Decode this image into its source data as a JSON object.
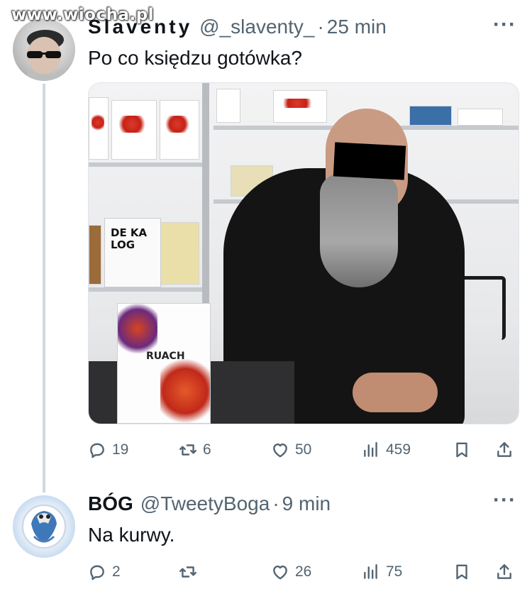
{
  "watermark": "www.wiocha.pl",
  "tweets": [
    {
      "display_name": "Slaventy",
      "handle": "@_slaventy_",
      "separator": "·",
      "time": "25 min",
      "text": "Po co księdzu gotówka?",
      "media": {
        "stand_book_title": "RUACH",
        "shelf_book_text": "DE KA LOG"
      },
      "actions": {
        "replies": "19",
        "reposts": "6",
        "likes": "50",
        "views": "459"
      }
    },
    {
      "display_name": "BÓG",
      "handle": "@TweetyBoga",
      "separator": "·",
      "time": "9 min",
      "text": "Na kurwy.",
      "actions": {
        "replies": "2",
        "reposts": "",
        "likes": "26",
        "views": "75"
      }
    }
  ],
  "more_icon": "···",
  "icons": [
    "reply-icon",
    "repost-icon",
    "like-icon",
    "views-icon",
    "bookmark-icon",
    "share-icon",
    "more-icon"
  ]
}
